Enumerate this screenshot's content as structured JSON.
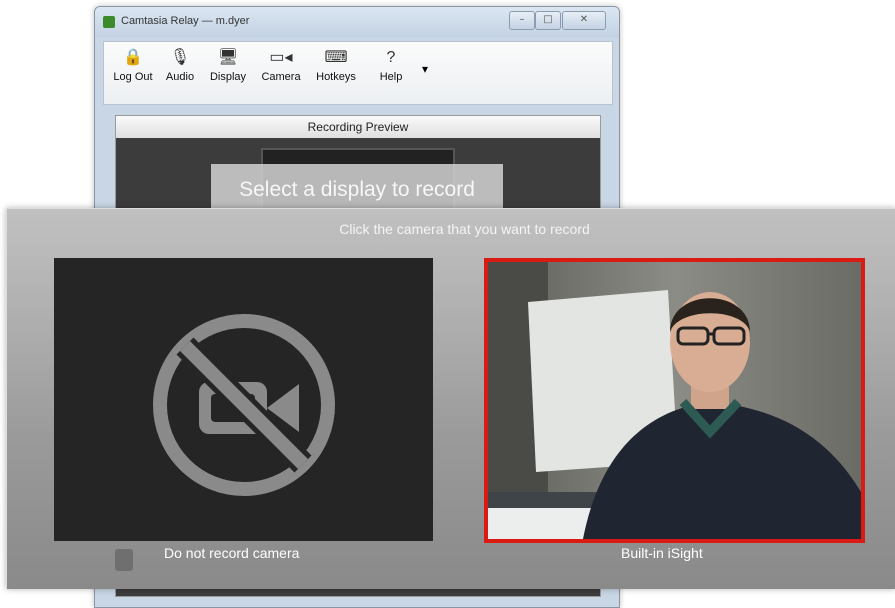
{
  "window": {
    "title": "Camtasia Relay — m.dyer",
    "controls": {
      "minimize": "–",
      "maximize": "□",
      "close": "✕"
    }
  },
  "toolbar": {
    "items": [
      {
        "label": "Log Out",
        "icon": "lock-icon",
        "glyph": "🔒"
      },
      {
        "label": "Audio",
        "icon": "microphone-icon",
        "glyph": "🎙"
      },
      {
        "label": "Display",
        "icon": "monitor-icon",
        "glyph": "🖥"
      },
      {
        "label": "Camera",
        "icon": "video-camera-icon",
        "glyph": "▭◂"
      },
      {
        "label": "Hotkeys",
        "icon": "keyboard-icon",
        "glyph": "⌨"
      },
      {
        "label": "Help",
        "icon": "question-icon",
        "glyph": "?"
      }
    ],
    "more": "▾"
  },
  "preview": {
    "header": "Recording Preview",
    "select_display": "Select a display to record"
  },
  "camera_overlay": {
    "instruction": "Click the camera that you want to record",
    "options": [
      {
        "label": "Do not record camera",
        "icon": "camera-disabled-icon",
        "selected": false
      },
      {
        "label": "Built-in iSight",
        "icon": "webcam-feed",
        "selected": true
      }
    ],
    "selection_color": "#d91b14"
  }
}
